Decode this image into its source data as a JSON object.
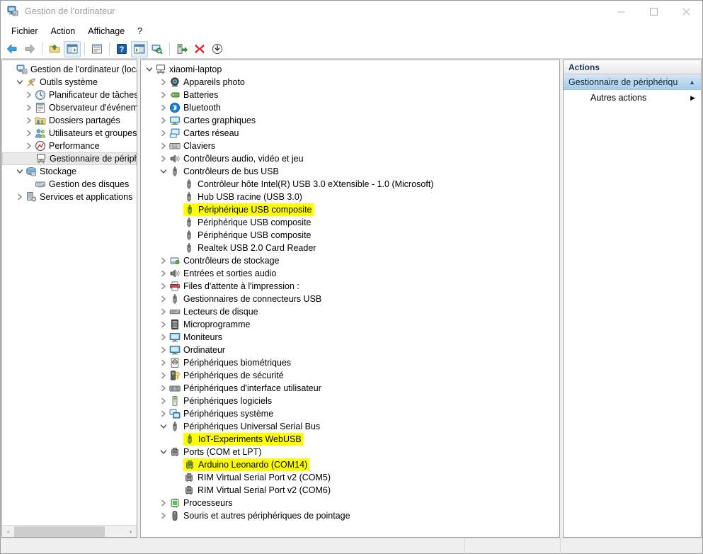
{
  "window": {
    "title": "Gestion de l'ordinateur",
    "icon": "computer-management-icon",
    "minimize_label": "—",
    "maximize_label": "□",
    "close_label": "✕"
  },
  "menubar": {
    "items": [
      {
        "label": "Fichier",
        "name": "menu-fichier"
      },
      {
        "label": "Action",
        "name": "menu-action"
      },
      {
        "label": "Affichage",
        "name": "menu-affichage"
      },
      {
        "label": "?",
        "name": "menu-help"
      }
    ]
  },
  "toolbar": {
    "buttons": [
      {
        "icon": "back-arrow-icon",
        "name": "toolbar-back",
        "pressed": false
      },
      {
        "icon": "forward-arrow-icon",
        "name": "toolbar-forward",
        "pressed": false
      },
      {
        "icon": "up-folder-icon",
        "name": "toolbar-up-level",
        "pressed": false
      },
      {
        "icon": "show-hide-tree-icon",
        "name": "toolbar-show-hide-console-tree",
        "pressed": true
      },
      {
        "icon": "properties-icon",
        "name": "toolbar-properties",
        "pressed": false
      },
      {
        "icon": "help-icon",
        "name": "toolbar-help",
        "pressed": false
      },
      {
        "icon": "show-action-pane-icon",
        "name": "toolbar-show-hide-action-pane",
        "pressed": true
      },
      {
        "icon": "scan-hardware-changes-icon",
        "name": "toolbar-scan-hardware-changes",
        "pressed": false
      },
      {
        "icon": "update-driver-icon",
        "name": "toolbar-update-driver",
        "pressed": false
      },
      {
        "icon": "uninstall-device-icon",
        "name": "toolbar-uninstall-device",
        "pressed": false
      },
      {
        "icon": "disable-device-icon",
        "name": "toolbar-disable-device",
        "pressed": false
      }
    ]
  },
  "console_tree": {
    "items": [
      {
        "label": "Gestion de l'ordinateur (local)",
        "indent": 0,
        "chevron": "none",
        "icon": "computer-management-icon",
        "selected": false
      },
      {
        "label": "Outils système",
        "indent": 1,
        "chevron": "expanded",
        "icon": "system-tools-icon",
        "selected": false
      },
      {
        "label": "Planificateur de tâches",
        "indent": 2,
        "chevron": "collapsed",
        "icon": "task-scheduler-icon",
        "selected": false
      },
      {
        "label": "Observateur d'événeme",
        "indent": 2,
        "chevron": "collapsed",
        "icon": "event-viewer-icon",
        "selected": false
      },
      {
        "label": "Dossiers partagés",
        "indent": 2,
        "chevron": "collapsed",
        "icon": "shared-folders-icon",
        "selected": false
      },
      {
        "label": "Utilisateurs et groupes l",
        "indent": 2,
        "chevron": "collapsed",
        "icon": "users-groups-icon",
        "selected": false
      },
      {
        "label": "Performance",
        "indent": 2,
        "chevron": "collapsed",
        "icon": "performance-icon",
        "selected": false
      },
      {
        "label": "Gestionnaire de périphé",
        "indent": 2,
        "chevron": "none",
        "icon": "device-manager-icon",
        "selected": true
      },
      {
        "label": "Stockage",
        "indent": 1,
        "chevron": "expanded",
        "icon": "storage-icon",
        "selected": false
      },
      {
        "label": "Gestion des disques",
        "indent": 2,
        "chevron": "none",
        "icon": "disk-management-icon",
        "selected": false
      },
      {
        "label": "Services et applications",
        "indent": 1,
        "chevron": "collapsed",
        "icon": "services-applications-icon",
        "selected": false
      }
    ],
    "hscroll": {
      "left_arrow": "‹",
      "right_arrow": "›"
    }
  },
  "device_tree": {
    "items": [
      {
        "label": "xiaomi-laptop",
        "indent": 0,
        "chevron": "expanded",
        "icon": "computer-icon",
        "highlight": false
      },
      {
        "label": "Appareils photo",
        "indent": 1,
        "chevron": "collapsed",
        "icon": "camera-icon",
        "highlight": false
      },
      {
        "label": "Batteries",
        "indent": 1,
        "chevron": "collapsed",
        "icon": "battery-icon",
        "highlight": false
      },
      {
        "label": "Bluetooth",
        "indent": 1,
        "chevron": "collapsed",
        "icon": "bluetooth-icon",
        "highlight": false
      },
      {
        "label": "Cartes graphiques",
        "indent": 1,
        "chevron": "collapsed",
        "icon": "display-adapter-icon",
        "highlight": false
      },
      {
        "label": "Cartes réseau",
        "indent": 1,
        "chevron": "collapsed",
        "icon": "network-adapter-icon",
        "highlight": false
      },
      {
        "label": "Claviers",
        "indent": 1,
        "chevron": "collapsed",
        "icon": "keyboard-icon",
        "highlight": false
      },
      {
        "label": "Contrôleurs audio, vidéo et jeu",
        "indent": 1,
        "chevron": "collapsed",
        "icon": "speaker-icon",
        "highlight": false
      },
      {
        "label": "Contrôleurs de bus USB",
        "indent": 1,
        "chevron": "expanded",
        "icon": "usb-icon",
        "highlight": false
      },
      {
        "label": "Contrôleur hôte Intel(R) USB 3.0 eXtensible - 1.0 (Microsoft)",
        "indent": 2,
        "chevron": "none",
        "icon": "usb-icon",
        "highlight": false
      },
      {
        "label": "Hub USB racine (USB 3.0)",
        "indent": 2,
        "chevron": "none",
        "icon": "usb-icon",
        "highlight": false
      },
      {
        "label": "Périphérique USB composite",
        "indent": 2,
        "chevron": "none",
        "icon": "usb-icon",
        "highlight": true
      },
      {
        "label": "Périphérique USB composite",
        "indent": 2,
        "chevron": "none",
        "icon": "usb-icon",
        "highlight": false
      },
      {
        "label": "Périphérique USB composite",
        "indent": 2,
        "chevron": "none",
        "icon": "usb-icon",
        "highlight": false
      },
      {
        "label": "Realtek USB 2.0 Card Reader",
        "indent": 2,
        "chevron": "none",
        "icon": "usb-icon",
        "highlight": false
      },
      {
        "label": "Contrôleurs de stockage",
        "indent": 1,
        "chevron": "collapsed",
        "icon": "storage-controller-icon",
        "highlight": false
      },
      {
        "label": "Entrées et sorties audio",
        "indent": 1,
        "chevron": "collapsed",
        "icon": "speaker-icon",
        "highlight": false
      },
      {
        "label": "Files d'attente à l'impression :",
        "indent": 1,
        "chevron": "collapsed",
        "icon": "printer-icon",
        "highlight": false
      },
      {
        "label": "Gestionnaires de connecteurs USB",
        "indent": 1,
        "chevron": "collapsed",
        "icon": "usb-icon",
        "highlight": false
      },
      {
        "label": "Lecteurs de disque",
        "indent": 1,
        "chevron": "collapsed",
        "icon": "disk-drive-icon",
        "highlight": false
      },
      {
        "label": "Microprogramme",
        "indent": 1,
        "chevron": "collapsed",
        "icon": "firmware-icon",
        "highlight": false
      },
      {
        "label": "Moniteurs",
        "indent": 1,
        "chevron": "collapsed",
        "icon": "monitor-icon",
        "highlight": false
      },
      {
        "label": "Ordinateur",
        "indent": 1,
        "chevron": "collapsed",
        "icon": "monitor-icon",
        "highlight": false
      },
      {
        "label": "Périphériques biométriques",
        "indent": 1,
        "chevron": "collapsed",
        "icon": "fingerprint-icon",
        "highlight": false
      },
      {
        "label": "Périphériques de sécurité",
        "indent": 1,
        "chevron": "collapsed",
        "icon": "security-device-icon",
        "highlight": false
      },
      {
        "label": "Périphériques d'interface utilisateur",
        "indent": 1,
        "chevron": "collapsed",
        "icon": "hid-icon",
        "highlight": false
      },
      {
        "label": "Périphériques logiciels",
        "indent": 1,
        "chevron": "collapsed",
        "icon": "software-device-icon",
        "highlight": false
      },
      {
        "label": "Périphériques système",
        "indent": 1,
        "chevron": "collapsed",
        "icon": "system-device-icon",
        "highlight": false
      },
      {
        "label": "Périphériques Universal Serial Bus",
        "indent": 1,
        "chevron": "expanded",
        "icon": "usb-icon",
        "highlight": false
      },
      {
        "label": "IoT-Experiments WebUSB",
        "indent": 2,
        "chevron": "none",
        "icon": "usb-icon",
        "highlight": true
      },
      {
        "label": "Ports (COM et LPT)",
        "indent": 1,
        "chevron": "expanded",
        "icon": "port-icon",
        "highlight": false
      },
      {
        "label": "Arduino Leonardo (COM14)",
        "indent": 2,
        "chevron": "none",
        "icon": "port-icon",
        "highlight": true
      },
      {
        "label": "RIM Virtual Serial Port v2 (COM5)",
        "indent": 2,
        "chevron": "none",
        "icon": "port-icon",
        "highlight": false
      },
      {
        "label": "RIM Virtual Serial Port v2 (COM6)",
        "indent": 2,
        "chevron": "none",
        "icon": "port-icon",
        "highlight": false
      },
      {
        "label": "Processeurs",
        "indent": 1,
        "chevron": "collapsed",
        "icon": "processor-icon",
        "highlight": false
      },
      {
        "label": "Souris et autres périphériques de pointage",
        "indent": 1,
        "chevron": "collapsed",
        "icon": "mouse-icon",
        "highlight": false
      }
    ]
  },
  "actions": {
    "header": "Actions",
    "group_label": "Gestionnaire de périphériqu",
    "group_caret": "▲",
    "items": [
      {
        "label": "Autres actions",
        "arrow": "▶",
        "name": "action-more-actions"
      }
    ]
  },
  "statusbar": {
    "text": ""
  },
  "colors": {
    "highlight": "#ffff00",
    "selection_gray": "#e8e8e8",
    "actions_group_blue": "#bdd9ef",
    "title_text": "#9a9a9a"
  }
}
